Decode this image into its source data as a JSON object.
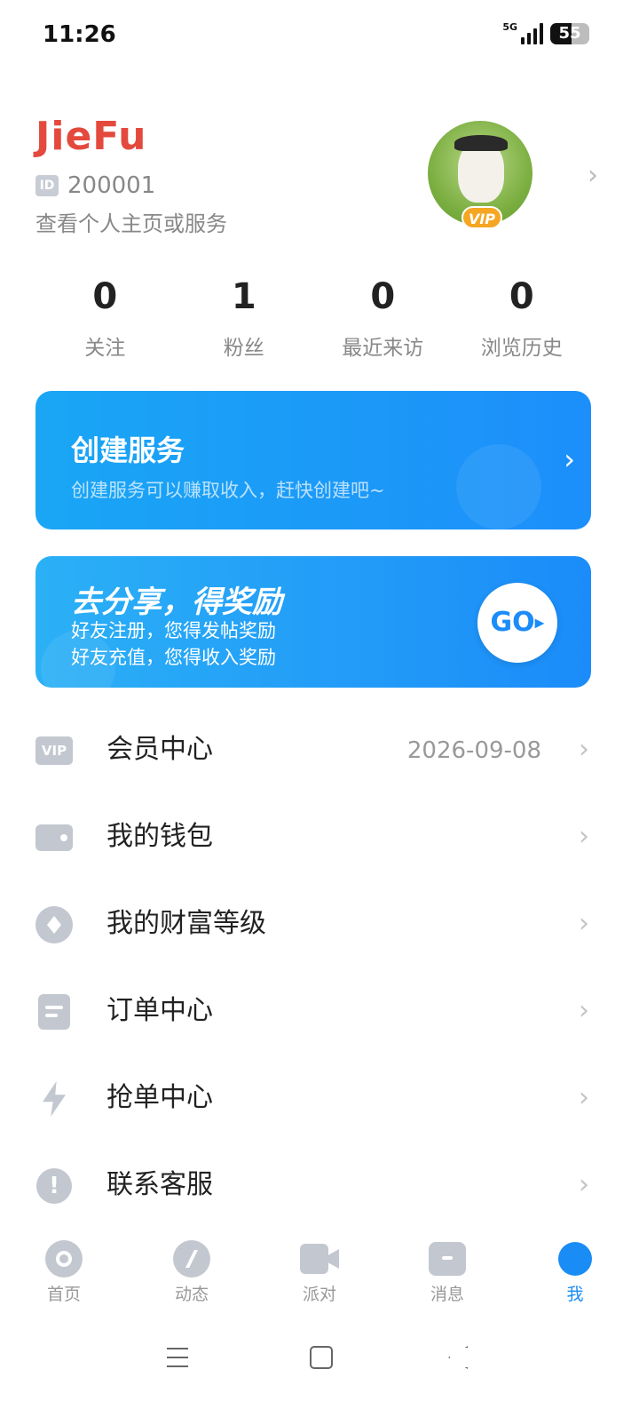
{
  "status_bar": {
    "time": "11:26",
    "network": "5G",
    "battery": "55",
    "battery_level": 0.55
  },
  "profile": {
    "nickname": "JieFu",
    "id_tag": "ID",
    "id_number": "200001",
    "hint": "查看个人主页或服务",
    "vip_badge": "VIP"
  },
  "stats": [
    {
      "value": "0",
      "label": "关注"
    },
    {
      "value": "1",
      "label": "粉丝"
    },
    {
      "value": "0",
      "label": "最近来访"
    },
    {
      "value": "0",
      "label": "浏览历史"
    }
  ],
  "create_card": {
    "title": "创建服务",
    "subtitle": "创建服务可以赚取收入，赶快创建吧~"
  },
  "share_card": {
    "title": "去分享，得奖励",
    "line1": "好友注册，您得发帖奖励",
    "line2": "好友充值，您得收入奖励",
    "button": "GO"
  },
  "menu": [
    {
      "label": "会员中心",
      "value": "2026-09-08",
      "icon": "vip-icon"
    },
    {
      "label": "我的钱包",
      "value": "",
      "icon": "wallet-icon"
    },
    {
      "label": "我的财富等级",
      "value": "",
      "icon": "diamond-icon"
    },
    {
      "label": "订单中心",
      "value": "",
      "icon": "order-icon"
    },
    {
      "label": "抢单中心",
      "value": "",
      "icon": "lightning-icon"
    },
    {
      "label": "联系客服",
      "value": "",
      "icon": "exclamation-icon"
    }
  ],
  "tabs": [
    {
      "label": "首页",
      "icon": "home-icon",
      "active": false
    },
    {
      "label": "动态",
      "icon": "compass-icon",
      "active": false
    },
    {
      "label": "派对",
      "icon": "video-icon",
      "active": false
    },
    {
      "label": "消息",
      "icon": "message-icon",
      "active": false
    },
    {
      "label": "我",
      "icon": "profile-icon",
      "active": true
    }
  ],
  "colors": {
    "accent": "#1a8cf5",
    "nickname": "#e4493d",
    "vip": "#f5a623"
  }
}
